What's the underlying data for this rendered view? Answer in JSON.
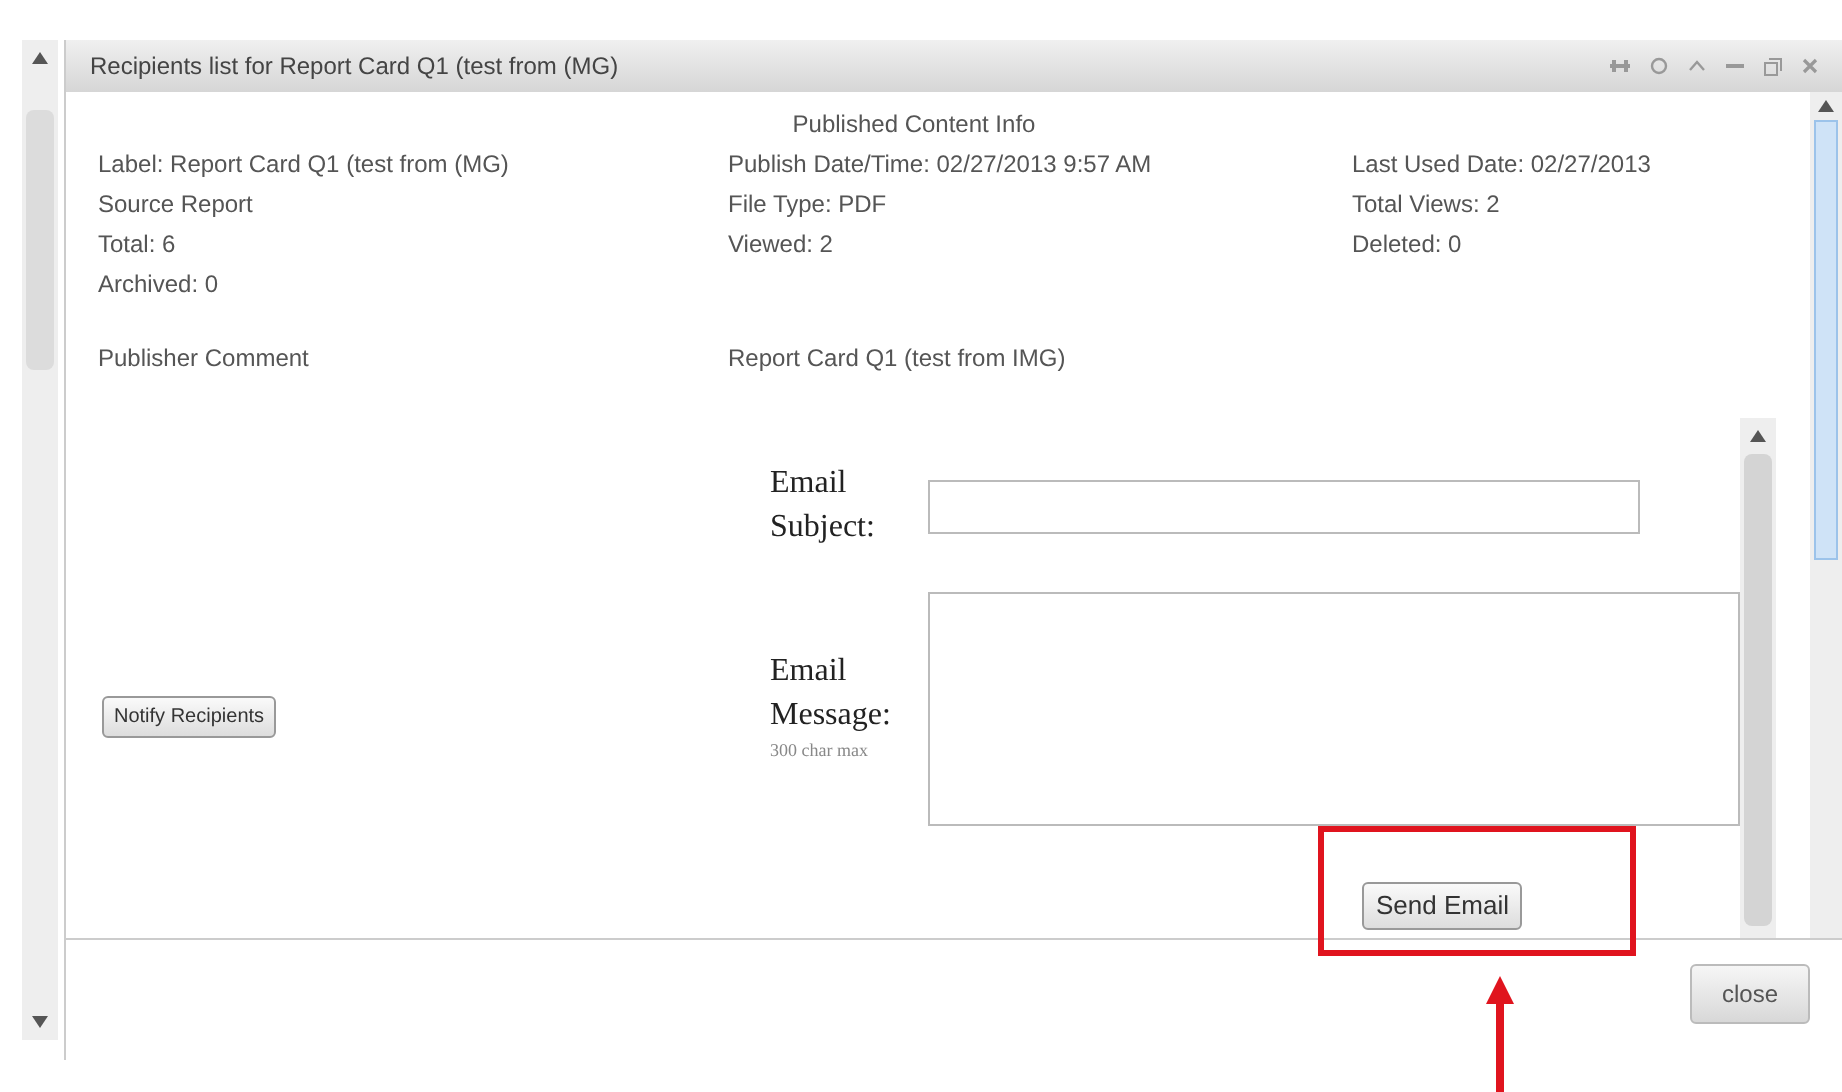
{
  "window": {
    "title": "Recipients list for Report Card Q1 (test from (MG)"
  },
  "info": {
    "header": "Published Content Info",
    "columns": [
      [
        "Label: Report Card Q1 (test from (MG)",
        "Source Report",
        "Total: 6",
        "Archived: 0"
      ],
      [
        "Publish Date/Time: 02/27/2013 9:57 AM",
        "File Type: PDF",
        "Viewed: 2"
      ],
      [
        "Last Used Date: 02/27/2013",
        "Total Views: 2",
        "Deleted: 0"
      ]
    ],
    "publisher_comment": {
      "label": "Publisher Comment",
      "value": "Report Card Q1 (test from IMG)"
    }
  },
  "notify_button": "Notify Recipients",
  "form": {
    "subject_label": "Email Subject:",
    "message_label": "Email Message:",
    "message_hint": "300 char max",
    "send_button": "Send Email"
  },
  "close_button": "close"
}
